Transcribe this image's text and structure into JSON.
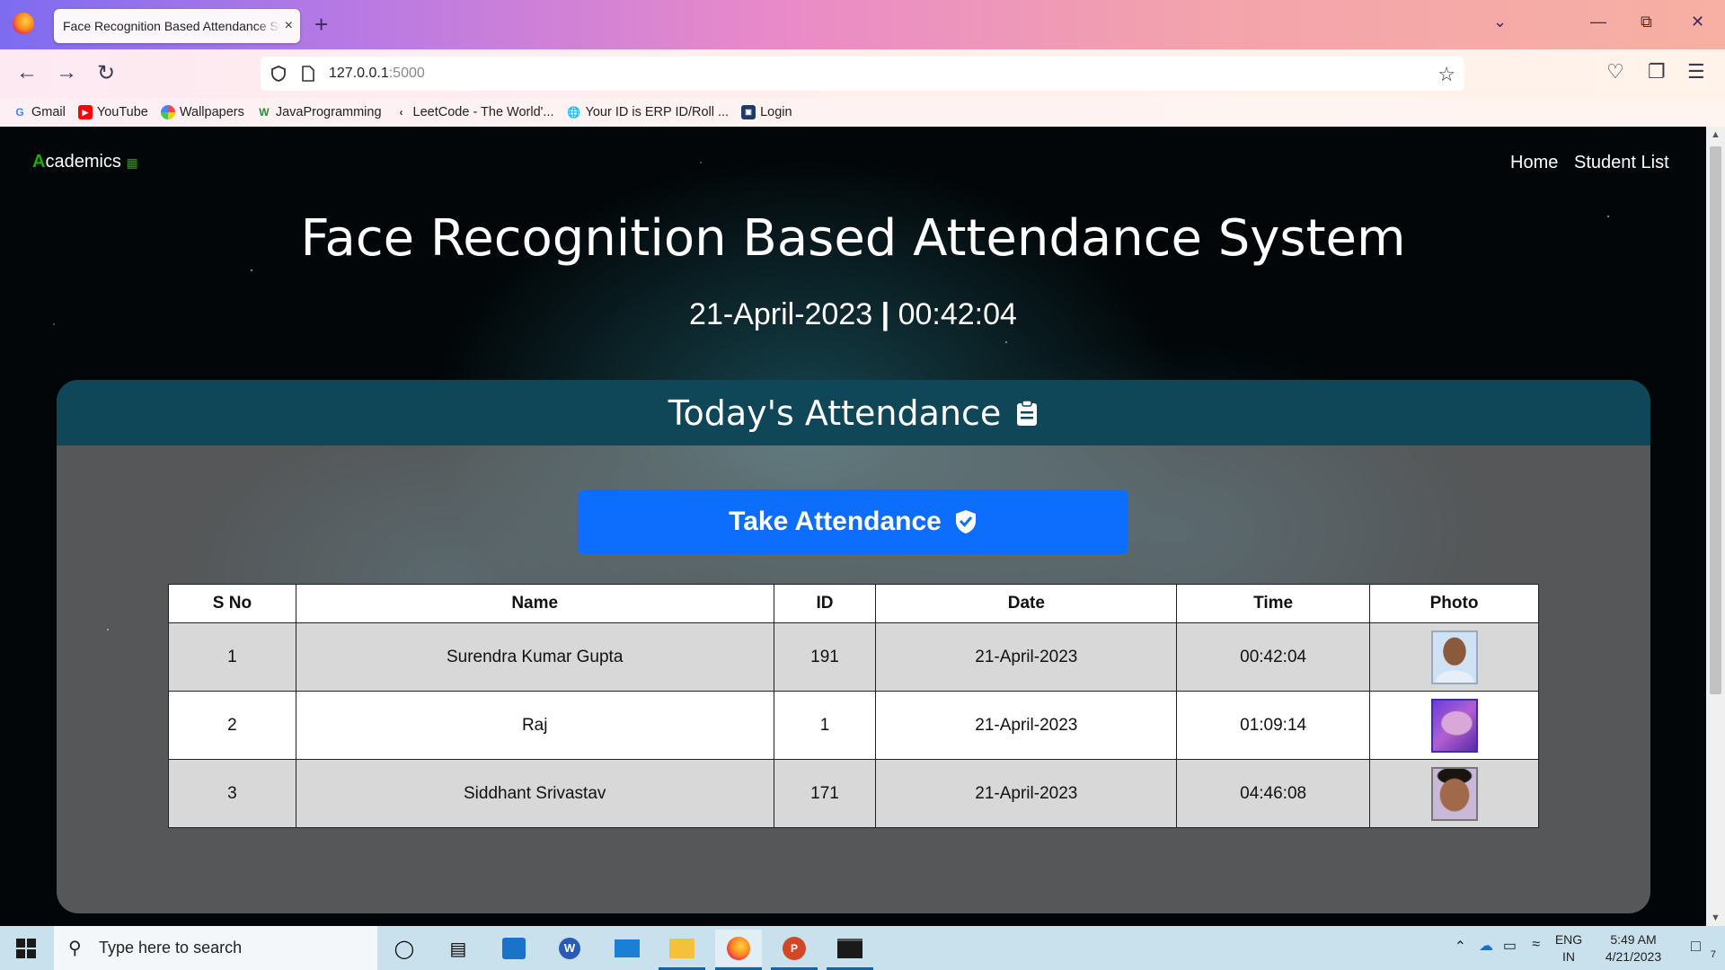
{
  "browser": {
    "tab_title": "Face Recognition Based Attendance System",
    "tab_close": "×",
    "new_tab": "+",
    "url_host": "127.0.0.1",
    "url_port": ":5000",
    "bookmarks": [
      {
        "label": "Gmail",
        "icon": "gmail-icon"
      },
      {
        "label": "YouTube",
        "icon": "youtube-icon"
      },
      {
        "label": "Wallpapers",
        "icon": "wallpapers-icon"
      },
      {
        "label": "JavaProgramming",
        "icon": "javaprogramming-icon"
      },
      {
        "label": "LeetCode - The World'...",
        "icon": "leetcode-icon"
      },
      {
        "label": "Your ID is ERP ID/Roll ...",
        "icon": "globe-icon"
      },
      {
        "label": "Login",
        "icon": "login-icon"
      }
    ]
  },
  "navbar": {
    "brand_first": "A",
    "brand_rest": "cademics",
    "links": [
      "Home",
      "Student List"
    ]
  },
  "header": {
    "title": "Face Recognition Based Attendance System",
    "date": "21-April-2023",
    "separator": "|",
    "time": "00:42:04"
  },
  "card": {
    "title": "Today's Attendance",
    "take_button": "Take Attendance"
  },
  "table": {
    "columns": [
      "S No",
      "Name",
      "ID",
      "Date",
      "Time",
      "Photo"
    ],
    "rows": [
      {
        "sno": "1",
        "name": "Surendra Kumar Gupta",
        "id": "191",
        "date": "21-April-2023",
        "time": "00:42:04"
      },
      {
        "sno": "2",
        "name": "Raj",
        "id": "1",
        "date": "21-April-2023",
        "time": "01:09:14"
      },
      {
        "sno": "3",
        "name": "Siddhant Srivastav",
        "id": "171",
        "date": "21-April-2023",
        "time": "04:46:08"
      }
    ]
  },
  "taskbar": {
    "search_placeholder": "Type here to search",
    "lang": "ENG",
    "region": "IN",
    "clock_time": "5:49 AM",
    "clock_date": "4/21/2023",
    "notification_count": "7"
  },
  "colors": {
    "brand_green": "#1faa00",
    "card_header": "#0f4658",
    "button_blue": "#0d6efd"
  }
}
